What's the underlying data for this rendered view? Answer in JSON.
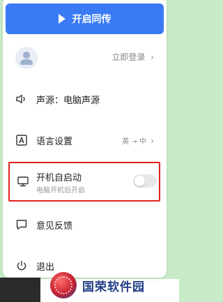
{
  "header": {
    "start_label": "开启同传"
  },
  "login": {
    "link": "立即登录",
    "chevron": "›"
  },
  "menu": {
    "source": {
      "label": "声源：电脑声源"
    },
    "language": {
      "label": "语言设置",
      "value": "英 → 中",
      "chevron": "›"
    },
    "autostart": {
      "title": "开机自启动",
      "subtitle": "电脑开机后开启",
      "enabled": false
    },
    "feedback": {
      "label": "意见反馈"
    },
    "logout": {
      "label": "退出"
    }
  },
  "branding": {
    "logo_text": "国荣软件园"
  },
  "colors": {
    "accent": "#3a7bf5",
    "highlight_border": "#e01f1f",
    "background": "#c8ecc8"
  }
}
